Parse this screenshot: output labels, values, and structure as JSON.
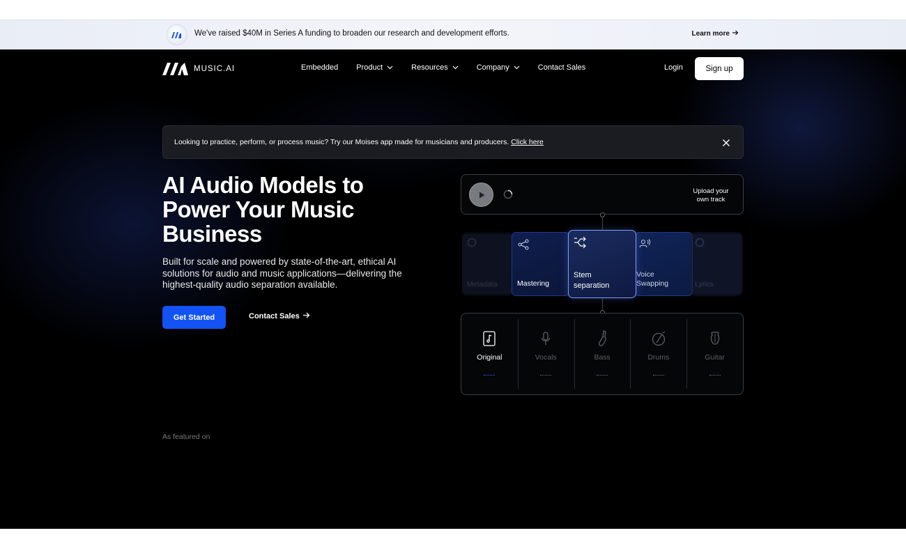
{
  "announcement": {
    "message": "We've raised $40M in Series A funding to broaden our research and development efforts.",
    "learn_more": "Learn more"
  },
  "brand": {
    "name": "MUSIC.AI"
  },
  "nav": {
    "items": [
      {
        "label": "Embedded"
      },
      {
        "label": "Product"
      },
      {
        "label": "Resources"
      },
      {
        "label": "Company"
      },
      {
        "label": "Contact Sales"
      }
    ],
    "login": "Login",
    "signup": "Sign up"
  },
  "notice": {
    "text": "Looking to practice, perform, or process music? Try our Moises app made for musicians and producers.",
    "link": "Click here"
  },
  "hero": {
    "headline": "AI Audio Models to Power Your Music Business",
    "subtext": "Built for scale and powered by state-of-the-art, ethical AI solutions for audio and music applications—delivering the highest-quality audio separation available.",
    "cta_primary": "Get Started",
    "cta_secondary": "Contact Sales"
  },
  "widget": {
    "upload_label": "Upload your own track",
    "cards": [
      {
        "label": "Metadata"
      },
      {
        "label": "Mastering"
      },
      {
        "label": "Stem separation"
      },
      {
        "label": "Voice Swapping"
      },
      {
        "label": "Lyrics"
      }
    ],
    "stems": [
      {
        "label": "Original",
        "icon": "music-file-icon"
      },
      {
        "label": "Vocals",
        "icon": "microphone-icon"
      },
      {
        "label": "Bass",
        "icon": "bass-guitar-icon"
      },
      {
        "label": "Drums",
        "icon": "drum-icon"
      },
      {
        "label": "Guitar",
        "icon": "guitar-icon"
      }
    ]
  },
  "featured": {
    "label": "As featured on"
  },
  "colors": {
    "accent": "#1352f3",
    "background": "#000000",
    "highlight_border": "#7e9bff"
  }
}
